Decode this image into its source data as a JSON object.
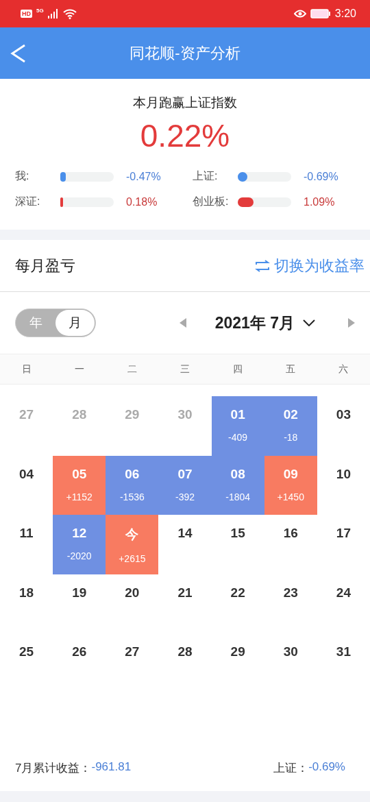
{
  "status_bar": {
    "hd": "HD",
    "network": "5G",
    "time": "3:20"
  },
  "header": {
    "title": "同花顺-资产分析"
  },
  "summary": {
    "title": "本月跑赢上证指数",
    "value": "0.22%",
    "bars": [
      {
        "label": "我:",
        "level": 0.1,
        "rising": false,
        "reading": "-0.47%"
      },
      {
        "label": "上证:",
        "level": 0.18,
        "rising": false,
        "reading": "-0.69%"
      },
      {
        "label": "深证:",
        "level": 0.03,
        "rising": true,
        "reading": "0.18%"
      },
      {
        "label": "创业板:",
        "level": 0.3,
        "rising": true,
        "reading": "1.09%"
      }
    ]
  },
  "monthly": {
    "title": "每月盈亏",
    "switch_label": "切换为收益率",
    "toggle": [
      {
        "label": "年",
        "selected": false
      },
      {
        "label": "月",
        "selected": true
      }
    ],
    "month": "2021年 7月",
    "weekdays": [
      "日",
      "一",
      "二",
      "三",
      "四",
      "五",
      "六"
    ],
    "weeks": [
      [
        {
          "day": "27",
          "muted": true,
          "kind": "plain"
        },
        {
          "day": "28",
          "muted": true,
          "kind": "plain"
        },
        {
          "day": "29",
          "muted": true,
          "kind": "plain"
        },
        {
          "day": "30",
          "muted": true,
          "kind": "plain"
        },
        {
          "day": "01",
          "muted": false,
          "kind": "loss",
          "value": "-409"
        },
        {
          "day": "02",
          "muted": false,
          "kind": "loss",
          "value": "-18"
        },
        {
          "day": "03",
          "muted": false,
          "kind": "plain"
        }
      ],
      [
        {
          "day": "04",
          "muted": false,
          "kind": "plain"
        },
        {
          "day": "05",
          "muted": false,
          "kind": "gain",
          "value": "+1152"
        },
        {
          "day": "06",
          "muted": false,
          "kind": "loss",
          "value": "-1536"
        },
        {
          "day": "07",
          "muted": false,
          "kind": "loss",
          "value": "-392"
        },
        {
          "day": "08",
          "muted": false,
          "kind": "loss",
          "value": "-1804"
        },
        {
          "day": "09",
          "muted": false,
          "kind": "gain",
          "value": "+1450"
        },
        {
          "day": "10",
          "muted": false,
          "kind": "plain"
        }
      ],
      [
        {
          "day": "11",
          "muted": false,
          "kind": "plain"
        },
        {
          "day": "12",
          "muted": false,
          "kind": "loss",
          "value": "-2020"
        },
        {
          "day": "今",
          "muted": false,
          "kind": "gain",
          "value": "+2615"
        },
        {
          "day": "14",
          "muted": false,
          "kind": "plain"
        },
        {
          "day": "15",
          "muted": false,
          "kind": "plain"
        },
        {
          "day": "16",
          "muted": false,
          "kind": "plain"
        },
        {
          "day": "17",
          "muted": false,
          "kind": "plain"
        }
      ],
      [
        {
          "day": "18",
          "muted": false,
          "kind": "plain"
        },
        {
          "day": "19",
          "muted": false,
          "kind": "plain"
        },
        {
          "day": "20",
          "muted": false,
          "kind": "plain"
        },
        {
          "day": "21",
          "muted": false,
          "kind": "plain"
        },
        {
          "day": "22",
          "muted": false,
          "kind": "plain"
        },
        {
          "day": "23",
          "muted": false,
          "kind": "plain"
        },
        {
          "day": "24",
          "muted": false,
          "kind": "plain"
        }
      ],
      [
        {
          "day": "25",
          "muted": false,
          "kind": "plain"
        },
        {
          "day": "26",
          "muted": false,
          "kind": "plain"
        },
        {
          "day": "27",
          "muted": false,
          "kind": "plain"
        },
        {
          "day": "28",
          "muted": false,
          "kind": "plain"
        },
        {
          "day": "29",
          "muted": false,
          "kind": "plain"
        },
        {
          "day": "30",
          "muted": false,
          "kind": "plain"
        },
        {
          "day": "31",
          "muted": false,
          "kind": "plain"
        }
      ]
    ],
    "footer": {
      "label": "7月累计收益：",
      "value": "-961.81",
      "index_label": "上证：",
      "index_value": "-0.69%"
    }
  }
}
